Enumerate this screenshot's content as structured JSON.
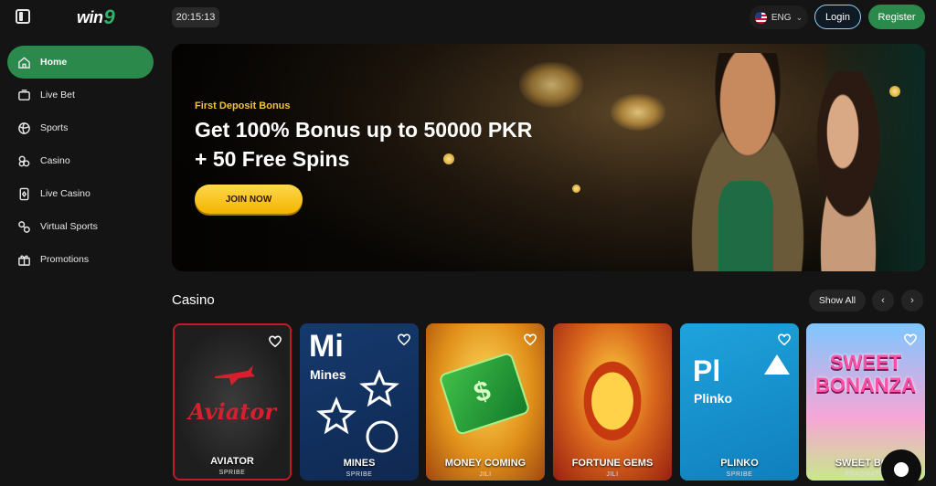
{
  "header": {
    "logo_text": "win",
    "logo_num": "9",
    "clock": "20:15:13",
    "language": "ENG",
    "login_label": "Login",
    "register_label": "Register"
  },
  "sidebar": {
    "items": [
      {
        "label": "Home",
        "icon": "home-icon",
        "active": true
      },
      {
        "label": "Live Bet",
        "icon": "live-bet-icon",
        "active": false
      },
      {
        "label": "Sports",
        "icon": "sports-ball-icon",
        "active": false
      },
      {
        "label": "Casino",
        "icon": "casino-chips-icon",
        "active": false
      },
      {
        "label": "Live Casino",
        "icon": "live-casino-icon",
        "active": false
      },
      {
        "label": "Virtual Sports",
        "icon": "virtual-sports-icon",
        "active": false
      },
      {
        "label": "Promotions",
        "icon": "gift-icon",
        "active": false
      }
    ]
  },
  "banner": {
    "subtitle": "First Deposit Bonus",
    "title_line1": "Get 100% Bonus up to 50000 PKR",
    "title_line2": "+ 50 Free Spins",
    "cta_label": "JOIN NOW"
  },
  "casino": {
    "section_title": "Casino",
    "show_all_label": "Show All",
    "prev_arrow": "‹",
    "next_arrow": "›",
    "games": [
      {
        "name": "AVIATOR",
        "provider": "SPRIBE",
        "art_text": "Aviator"
      },
      {
        "name": "MINES",
        "provider": "SPRIBE",
        "art_text": "Mi",
        "art_sub": "Mines"
      },
      {
        "name": "MONEY COMING",
        "provider": "JILI"
      },
      {
        "name": "FORTUNE GEMS",
        "provider": "JILI"
      },
      {
        "name": "PLINKO",
        "provider": "SPRIBE",
        "art_text": "Pl",
        "art_sub": "Plinko"
      },
      {
        "name": "SWEET BON",
        "provider": "PRAGMATIC",
        "art_text": "SWEET BONANZA"
      }
    ]
  },
  "colors": {
    "accent_green": "#2b8a4b",
    "cta_yellow": "#f2b400",
    "background": "#141414"
  }
}
